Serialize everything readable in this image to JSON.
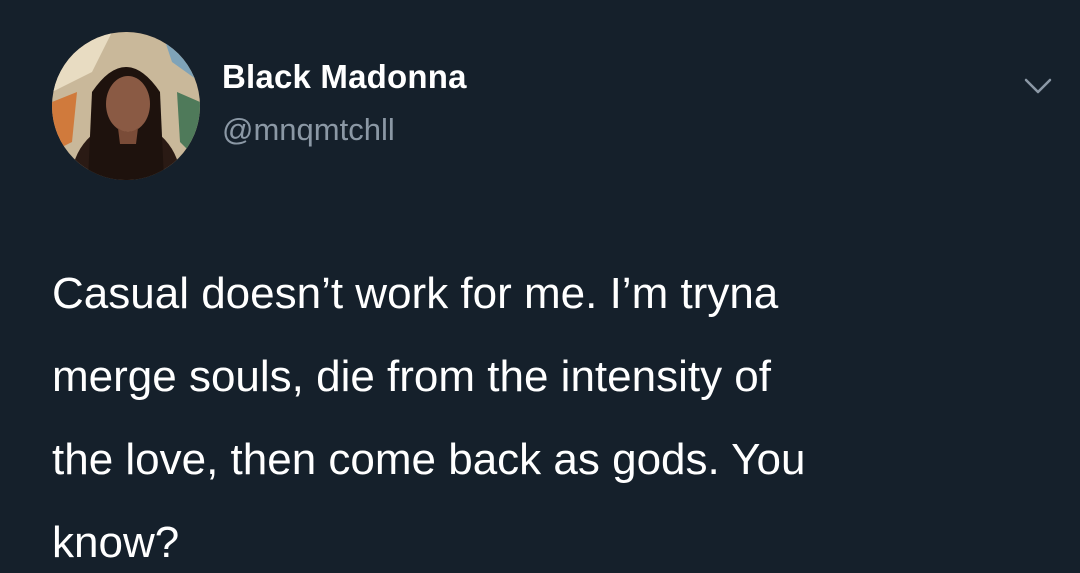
{
  "author": {
    "display_name": "Black Madonna",
    "handle": "@mnqmtchll"
  },
  "tweet": {
    "text": "Casual doesn’t work for me. I’m tryna\nmerge souls, die from the intensity of\nthe love, then come back as gods. You\nknow?"
  },
  "icons": {
    "menu": "chevron-down-icon",
    "avatar": "profile-photo"
  },
  "colors": {
    "background": "#15202b",
    "primary_text": "#ffffff",
    "secondary_text": "#8b98a5"
  }
}
